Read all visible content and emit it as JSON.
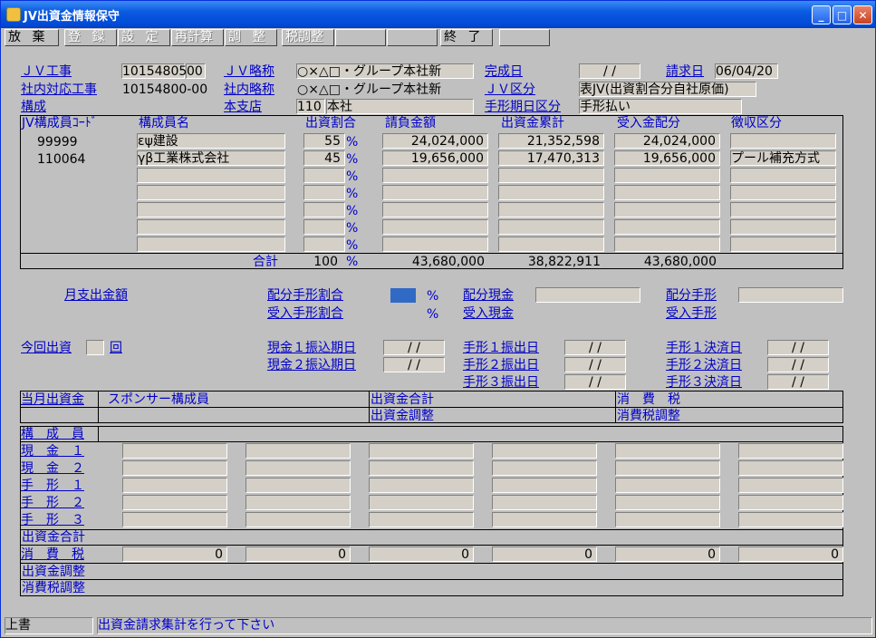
{
  "window": {
    "title": "JV出資金情報保守"
  },
  "toolbar": {
    "buttons": [
      {
        "label": "放 棄",
        "enabled": true
      },
      {
        "label": "登 録",
        "enabled": false
      },
      {
        "label": "設 定",
        "enabled": false
      },
      {
        "label": "再計算",
        "enabled": false
      },
      {
        "label": "調 整",
        "enabled": false
      },
      {
        "label": "税調整",
        "enabled": false
      },
      {
        "label": "",
        "enabled": false
      },
      {
        "label": "",
        "enabled": false
      },
      {
        "label": "終 了",
        "enabled": true
      },
      {
        "label": "",
        "enabled": false
      }
    ]
  },
  "header": {
    "jv_kouji_label": "ＪＶ工事",
    "jv_kouji_value": "10154805",
    "jv_kouji_suffix": "00",
    "jv_ryaku_label": "ＪＶ略称",
    "jv_ryaku_value": "○×△□・グループ本社新",
    "kansei_label": "完成日",
    "kansei_value": " /  / ",
    "seikyu_label": "請求日",
    "seikyu_value": "06/04/20",
    "shanai_kouji_label": "社内対応工事",
    "shanai_kouji_value": "10154800-00",
    "shanai_ryaku_label": "社内略称",
    "shanai_ryaku_value": "○×△□・グループ本社新",
    "jv_kubun_label": "ＪＶ区分",
    "jv_kubun_value": "表JV(出資割合分自社原価)",
    "koseki_label": "構成",
    "honshiten_label": "本支店",
    "honshiten_code": "110",
    "honshiten_name": "本社",
    "tegata_label": "手形期日区分",
    "tegata_value": "手形払い"
  },
  "members": {
    "columns": [
      "JV構成員ｺｰﾄﾞ",
      "構成員名",
      "出資割合",
      "請負金額",
      "出資金累計",
      "受入金配分",
      "徴収区分"
    ],
    "rows": [
      {
        "code": "99999",
        "name": "εψ建設",
        "ratio": "55",
        "pct": "%",
        "ukeoi": "24,024,000",
        "ruikei": "21,352,598",
        "haibun": "24,024,000",
        "choshu": ""
      },
      {
        "code": "110064",
        "name": "γβ工業株式会社",
        "ratio": "45",
        "pct": "%",
        "ukeoi": "19,656,000",
        "ruikei": "17,470,313",
        "haibun": "19,656,000",
        "choshu": "プール補充方式"
      },
      {
        "code": "",
        "name": "",
        "ratio": "",
        "pct": "%",
        "ukeoi": "",
        "ruikei": "",
        "haibun": "",
        "choshu": ""
      },
      {
        "code": "",
        "name": "",
        "ratio": "",
        "pct": "%",
        "ukeoi": "",
        "ruikei": "",
        "haibun": "",
        "choshu": ""
      },
      {
        "code": "",
        "name": "",
        "ratio": "",
        "pct": "%",
        "ukeoi": "",
        "ruikei": "",
        "haibun": "",
        "choshu": ""
      },
      {
        "code": "",
        "name": "",
        "ratio": "",
        "pct": "%",
        "ukeoi": "",
        "ruikei": "",
        "haibun": "",
        "choshu": ""
      },
      {
        "code": "",
        "name": "",
        "ratio": "",
        "pct": "%",
        "ukeoi": "",
        "ruikei": "",
        "haibun": "",
        "choshu": ""
      }
    ],
    "total_label": "合計",
    "total_ratio": "100",
    "total_pct": "%",
    "total_ukeoi": "43,680,000",
    "total_ruikei": "38,822,911",
    "total_haibun": "43,680,000"
  },
  "mid": {
    "getsushi_label": "月支出金額",
    "haibun_tegata_wariai": "配分手形割合",
    "ukeire_tegata_wariai": "受入手形割合",
    "pct": "%",
    "haibun_genkin": "配分現金",
    "ukeire_genkin": "受入現金",
    "haibun_tegata": "配分手形",
    "ukeire_tegata": "受入手形",
    "konkai_label": "今回出資",
    "kai_label": "回",
    "genkin1": "現金１振込期日",
    "genkin2": "現金２振込期日",
    "tegata1_furi": "手形１振出日",
    "tegata2_furi": "手形２振出日",
    "tegata3_furi": "手形３振出日",
    "tegata1_kessai": "手形１決済日",
    "tegata2_kessai": "手形２決済日",
    "tegata3_kessai": "手形３決済日",
    "date_blank": " /  / "
  },
  "lower": {
    "tougetsu_label": "当月出資金",
    "sponsor_label": "スポンサー構成員",
    "goukei_label": "出資金合計",
    "chosei_label": "出資金調整",
    "shohizei_label": "消　費　税",
    "zei_chosei_label": "消費税調整",
    "rows": [
      "構　成　員",
      "現　金　１",
      "現　金　２",
      "手　形　１",
      "手　形　２",
      "手　形　３"
    ],
    "goukei_row": "出資金合計",
    "shohizei_row": "消　費　税",
    "zero_values": [
      "0",
      "0",
      "0",
      "0",
      "0",
      "0"
    ],
    "chosei_row": "出資金調整",
    "zei_row": "消費税調整"
  },
  "status": {
    "mode": "上書",
    "message": "出資金請求集計を行って下さい"
  }
}
